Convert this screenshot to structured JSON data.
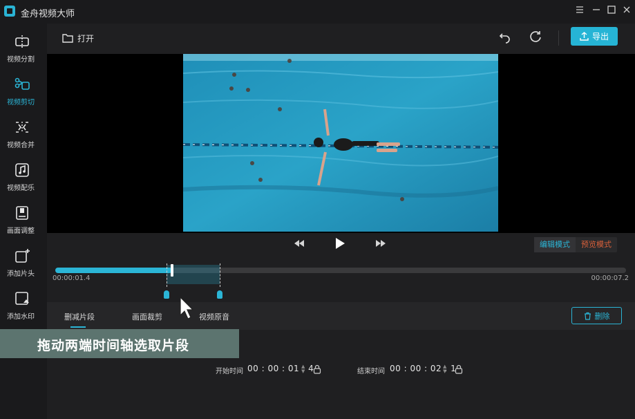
{
  "window": {
    "title": "金舟视频大师",
    "controls": [
      "menu-icon",
      "minimize-icon",
      "maximize-icon",
      "close-icon"
    ]
  },
  "sidebar": {
    "items": [
      {
        "label": "视频分割",
        "icon": "split-icon",
        "active": false
      },
      {
        "label": "视频剪切",
        "icon": "cut-icon",
        "active": true
      },
      {
        "label": "视频合并",
        "icon": "merge-icon",
        "active": false
      },
      {
        "label": "视频配乐",
        "icon": "music-icon",
        "active": false
      },
      {
        "label": "画面调整",
        "icon": "adjust-icon",
        "active": false
      },
      {
        "label": "添加片头",
        "icon": "add-intro-icon",
        "active": false
      },
      {
        "label": "添加水印",
        "icon": "watermark-icon",
        "active": false
      }
    ]
  },
  "toolbar": {
    "open_label": "打开",
    "undo_icon": "undo-icon",
    "redo_icon": "redo-icon",
    "export_label": "导出"
  },
  "player": {
    "controls": [
      "rewind-icon",
      "play-icon",
      "fast-forward-icon"
    ],
    "modes": {
      "edit": "编辑模式",
      "preview": "预览模式",
      "active": "edit"
    }
  },
  "timeline": {
    "current_time": "00:00:01.4",
    "total_time": "00:00:07.2",
    "progress_fraction": 0.205,
    "selection_start_fraction": 0.195,
    "selection_end_fraction": 0.288
  },
  "tabs": {
    "items": [
      "删减片段",
      "画面裁剪",
      "视频原音"
    ],
    "active_index": 0,
    "delete_label": "删除"
  },
  "fields": {
    "start_label": "开始时间",
    "start_value": "00 : 00 : 01 . 4",
    "end_label": "结束时间",
    "end_value": "00 : 00 : 02 . 1"
  },
  "caption": {
    "text": "拖动两端时间轴选取片段"
  },
  "colors": {
    "accent": "#2bb5d6",
    "preview_mode": "#d9603a",
    "background": "#1e1e20"
  }
}
